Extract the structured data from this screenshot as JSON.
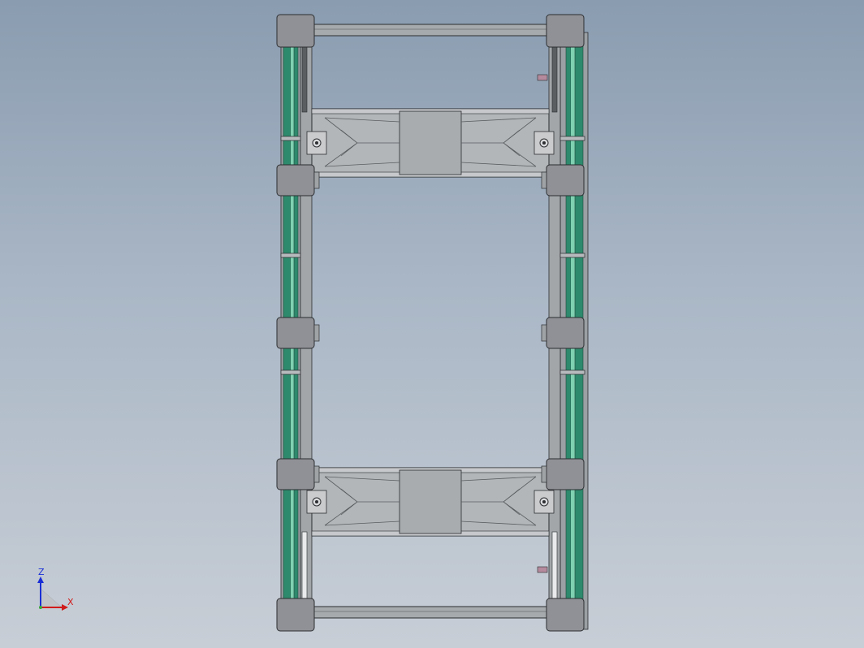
{
  "triad": {
    "z_label": "Z",
    "x_label": "X"
  },
  "colors": {
    "frame": "#9ea1a4",
    "frame_dark": "#6d7073",
    "pad": "#8f9196",
    "rail_green": "#2e8a6c",
    "rail_light": "#7fd1b1",
    "outline": "#2b2d30",
    "marker": "#b48a9c",
    "axis_z": "#1a2fd6",
    "axis_x": "#d01b1b",
    "axis_y": "#3aa33a"
  }
}
